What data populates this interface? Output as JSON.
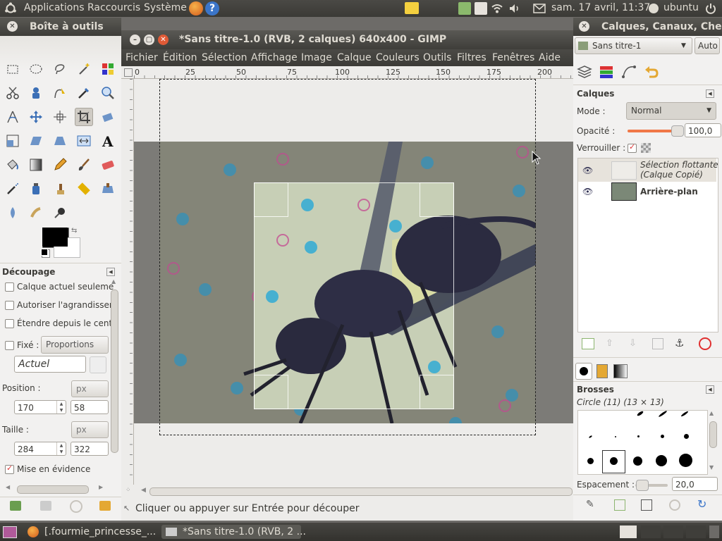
{
  "top_panel": {
    "applications": "Applications",
    "shortcuts": "Raccourcis",
    "system": "Système",
    "clock": "sam. 17 avril, 11:37",
    "user": "ubuntu"
  },
  "toolbox": {
    "title": "Boîte à outils",
    "tool_options_title": "Découpage",
    "opt_current_layer": "Calque actuel seuleme",
    "opt_allow_grow": "Autoriser l'agrandisser",
    "opt_expand_center": "Étendre depuis le centr",
    "opt_fixed": "Fixé :",
    "fixed_mode": "Proportions",
    "fixed_value": "Actuel",
    "position_label": "Position :",
    "position_unit": "px",
    "position_x": "170",
    "position_y": "58",
    "size_label": "Taille :",
    "size_unit": "px",
    "size_w": "284",
    "size_h": "322",
    "highlight_label": "Mise en évidence"
  },
  "gimp": {
    "title": "*Sans titre-1.0 (RVB, 2 calques) 640x400 - GIMP",
    "menus": [
      "Fichier",
      "Édition",
      "Sélection",
      "Affichage",
      "Image",
      "Calque",
      "Couleurs",
      "Outils",
      "Filtres",
      "Fenêtres",
      "Aide"
    ],
    "ruler_h": [
      "0",
      "25",
      "50",
      "75",
      "100",
      "125",
      "150",
      "175",
      "200"
    ],
    "ruler_v": [
      "25",
      "0",
      "25",
      "50",
      "75",
      "100",
      "125",
      "150"
    ],
    "status": "Cliquer ou appuyer sur Entrée pour découper"
  },
  "layers_dock": {
    "title": "Calques, Canaux, Che",
    "image_select": "Sans titre-1",
    "auto_button": "Auto",
    "section_title": "Calques",
    "mode_label": "Mode :",
    "mode_value": "Normal",
    "opacity_label": "Opacité :",
    "opacity_value": "100,0",
    "lock_label": "Verrouiller :",
    "layers": [
      {
        "name": "Sélection flottante\n(Calque Copié)"
      },
      {
        "name": "Arrière-plan"
      }
    ],
    "brushes_title": "Brosses",
    "brush_name": "Circle (11) (13 × 13)",
    "spacing_label": "Espacement :",
    "spacing_value": "20,0"
  },
  "taskbar": {
    "items": [
      "[.fourmie_princesse_...",
      "*Sans titre-1.0 (RVB, 2 ..."
    ]
  },
  "colors": {
    "panel_dark": "#3c3b37",
    "accent_orange": "#f07746",
    "canvas_bg": "#6d6b68"
  }
}
